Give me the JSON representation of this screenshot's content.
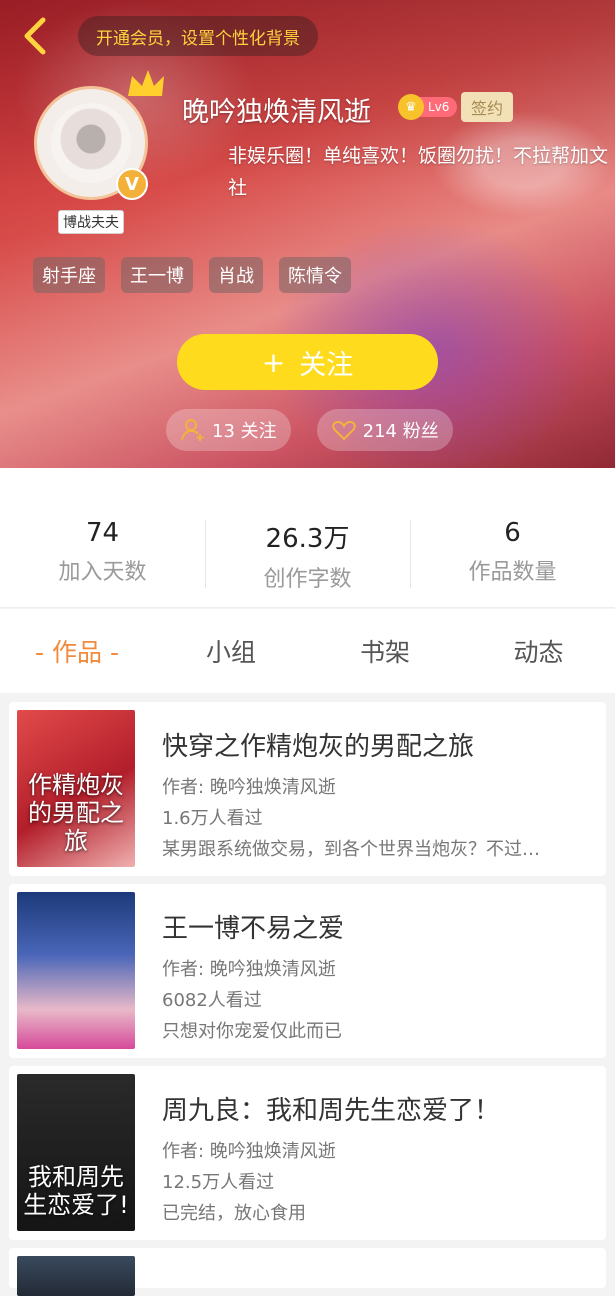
{
  "header": {
    "vip_banner": "开通会员，设置个性化背景",
    "avatar_tag": "博战夫夫",
    "username": "晚吟独焕清风逝",
    "level": "Lv6",
    "sign_label": "签约",
    "bio": "非娱乐圈！单纯喜欢！饭圈勿扰！不拉帮加文社",
    "tags": [
      "射手座",
      "王一博",
      "肖战",
      "陈情令"
    ],
    "follow_label": "关注",
    "follow_plus": "+",
    "following_count": "13 关注",
    "fans_count": "214 粉丝"
  },
  "stats": [
    {
      "value": "74",
      "label": "加入天数"
    },
    {
      "value": "26.3万",
      "label": "创作字数"
    },
    {
      "value": "6",
      "label": "作品数量"
    }
  ],
  "tabs": [
    "- 作品 -",
    "小组",
    "书架",
    "动态"
  ],
  "books": [
    {
      "title": "快穿之作精炮灰的男配之旅",
      "author": "作者: 晚吟独焕清风逝",
      "views": "1.6万人看过",
      "desc": "某男跟系统做交易，到各个世界当炮灰？不过…",
      "cover_text": "作精炮灰的男配之旅"
    },
    {
      "title": "王一博不易之爱",
      "author": "作者: 晚吟独焕清风逝",
      "views": "6082人看过",
      "desc": "只想对你宠爱仅此而已",
      "cover_text": ""
    },
    {
      "title": "周九良：我和周先生恋爱了！",
      "author": "作者: 晚吟独焕清风逝",
      "views": "12.5万人看过",
      "desc": "已完结，放心食用",
      "cover_text": "我和周先生恋爱了!"
    }
  ],
  "colors": {
    "accent": "#f08a3c",
    "follow_yellow": "#ffdb1d",
    "vip_text": "#ffd33d"
  }
}
